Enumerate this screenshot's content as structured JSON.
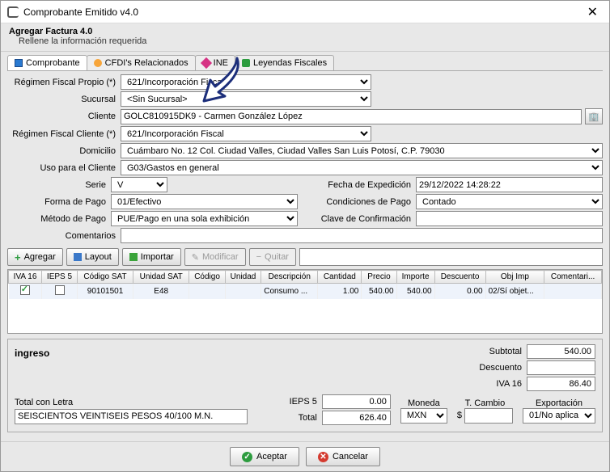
{
  "window": {
    "title": "Comprobante Emitido v4.0"
  },
  "header": {
    "title": "Agregar Factura 4.0",
    "subtitle": "Rellene la información requerida"
  },
  "tabs": {
    "comprobante": "Comprobante",
    "cfdis": "CFDI's Relacionados",
    "ine": "INE",
    "leyendas": "Leyendas Fiscales"
  },
  "form": {
    "labels": {
      "regimen_propio": "Régimen Fiscal Propio (*)",
      "sucursal": "Sucursal",
      "cliente": "Cliente",
      "regimen_cliente": "Régimen Fiscal Cliente (*)",
      "domicilio": "Domicilio",
      "uso": "Uso para el Cliente",
      "serie": "Serie",
      "fecha": "Fecha de Expedición",
      "forma": "Forma de Pago",
      "condiciones": "Condiciones de Pago",
      "metodo": "Método de Pago",
      "clave_conf": "Clave de Confirmación",
      "comentarios": "Comentarios"
    },
    "regimen_propio": "621/Incorporación Fiscal",
    "sucursal": "<Sin Sucursal>",
    "cliente": "GOLC810915DK9 - Carmen González López",
    "regimen_cliente": "621/Incorporación Fiscal",
    "domicilio": "Cuámbaro No. 12 Col. Ciudad Valles, Ciudad Valles San Luis Potosí, C.P. 79030",
    "uso": "G03/Gastos en general",
    "serie": "V",
    "fecha": "29/12/2022 14:28:22",
    "forma": "01/Efectivo",
    "condiciones": "Contado",
    "metodo": "PUE/Pago en una sola exhibición",
    "clave_conf": "",
    "comentarios": ""
  },
  "toolbar": {
    "agregar": "Agregar",
    "layout": "Layout",
    "importar": "Importar",
    "modificar": "Modificar",
    "quitar": "Quitar"
  },
  "grid": {
    "headers": [
      "IVA 16",
      "IEPS 5",
      "Código SAT",
      "Unidad SAT",
      "Código",
      "Unidad",
      "Descripción",
      "Cantidad",
      "Precio",
      "Importe",
      "Descuento",
      "Obj Imp",
      "Comentari..."
    ],
    "row": {
      "iva16_checked": true,
      "ieps5_checked": false,
      "codigo_sat": "90101501",
      "unidad_sat": "E48",
      "codigo": "",
      "unidad": "",
      "descripcion": "Consumo ...",
      "cantidad": "1.00",
      "precio": "540.00",
      "importe": "540.00",
      "descuento": "0.00",
      "obj_imp": "02/Sí objet...",
      "coment": ""
    }
  },
  "summary": {
    "ingreso": "ingreso",
    "labels": {
      "subtotal": "Subtotal",
      "descuento": "Descuento",
      "iva16": "IVA 16",
      "ieps5": "IEPS 5",
      "total": "Total",
      "total_letra": "Total con Letra",
      "moneda": "Moneda",
      "tcambio": "T. Cambio",
      "exportacion": "Exportación"
    },
    "subtotal": "540.00",
    "descuento": "",
    "iva16": "86.40",
    "ieps5": "0.00",
    "total": "626.40",
    "total_letra": "SEISCIENTOS VEINTISEIS PESOS 40/100 M.N.",
    "moneda": "MXN",
    "tcambio": "",
    "exportacion": "01/No aplica"
  },
  "footer": {
    "aceptar": "Aceptar",
    "cancelar": "Cancelar"
  }
}
